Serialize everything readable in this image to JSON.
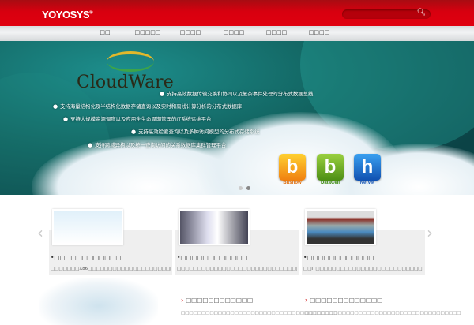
{
  "header": {
    "logo": "YOYOSYS",
    "logo_mark": "®",
    "search_placeholder": "",
    "search_icon": "search-icon"
  },
  "nav": [
    "□□",
    "□□□□□",
    "□□□□",
    "□□□□",
    "□□□□",
    "□□□□"
  ],
  "banner": {
    "brand": "CloudWare",
    "bullets": [
      "支持高效数据传输交换和协同以及复杂事件处理的分布式数据总线",
      "支持海量结构化及半结构化数据存储查询以及实时和离线计算分析的分布式数据库",
      "支持大规模资源调度以及应用全生命周期管理的IT系统运维平台",
      "支持高效检索查询以及多种访问模型的分布式存储系统",
      "支持跨域异构以及统一查询访问的关系数据库集群管理平台"
    ],
    "products": [
      {
        "name": "Bitsflow",
        "color": "#f0a010"
      },
      {
        "name": "DataCell",
        "color": "#6aa81e"
      },
      {
        "name": "NetVM",
        "color": "#1c6fd0"
      }
    ]
  },
  "cards": [
    {
      "title": "•□□□□□□□□□□□□□",
      "desc": "□□□□□□□X86□□□□□□□□□□□□□□□□□□□□□□□□□□□□□□□□"
    },
    {
      "title": "•□□□□□□□□□□□□",
      "desc": "□□□□□□□□□□□□□□□□□□□□□□□□□□□□□□□□□□□□□□□□□□□□□"
    },
    {
      "title": "•□□□□□□□□□□□□",
      "desc": "□□IT□□□□□□□□□□□□□□□□□□□□□□□□□□□□□□□□□□□□□□□□□"
    }
  ],
  "news": [
    {
      "title": "□□□□□□□□□□□□",
      "desc": "□□□□□□□□□□□□□□□□□□□□□□□□□□□□□□□□□□□□□□"
    },
    {
      "title": "□□□□□□□□□□□□□",
      "desc": "□□□□□□□□□□□□□□□□□□□□□□□□□□□□□□□□□□□□□□"
    }
  ],
  "carousel": {
    "prev": "‹",
    "next": "›"
  }
}
